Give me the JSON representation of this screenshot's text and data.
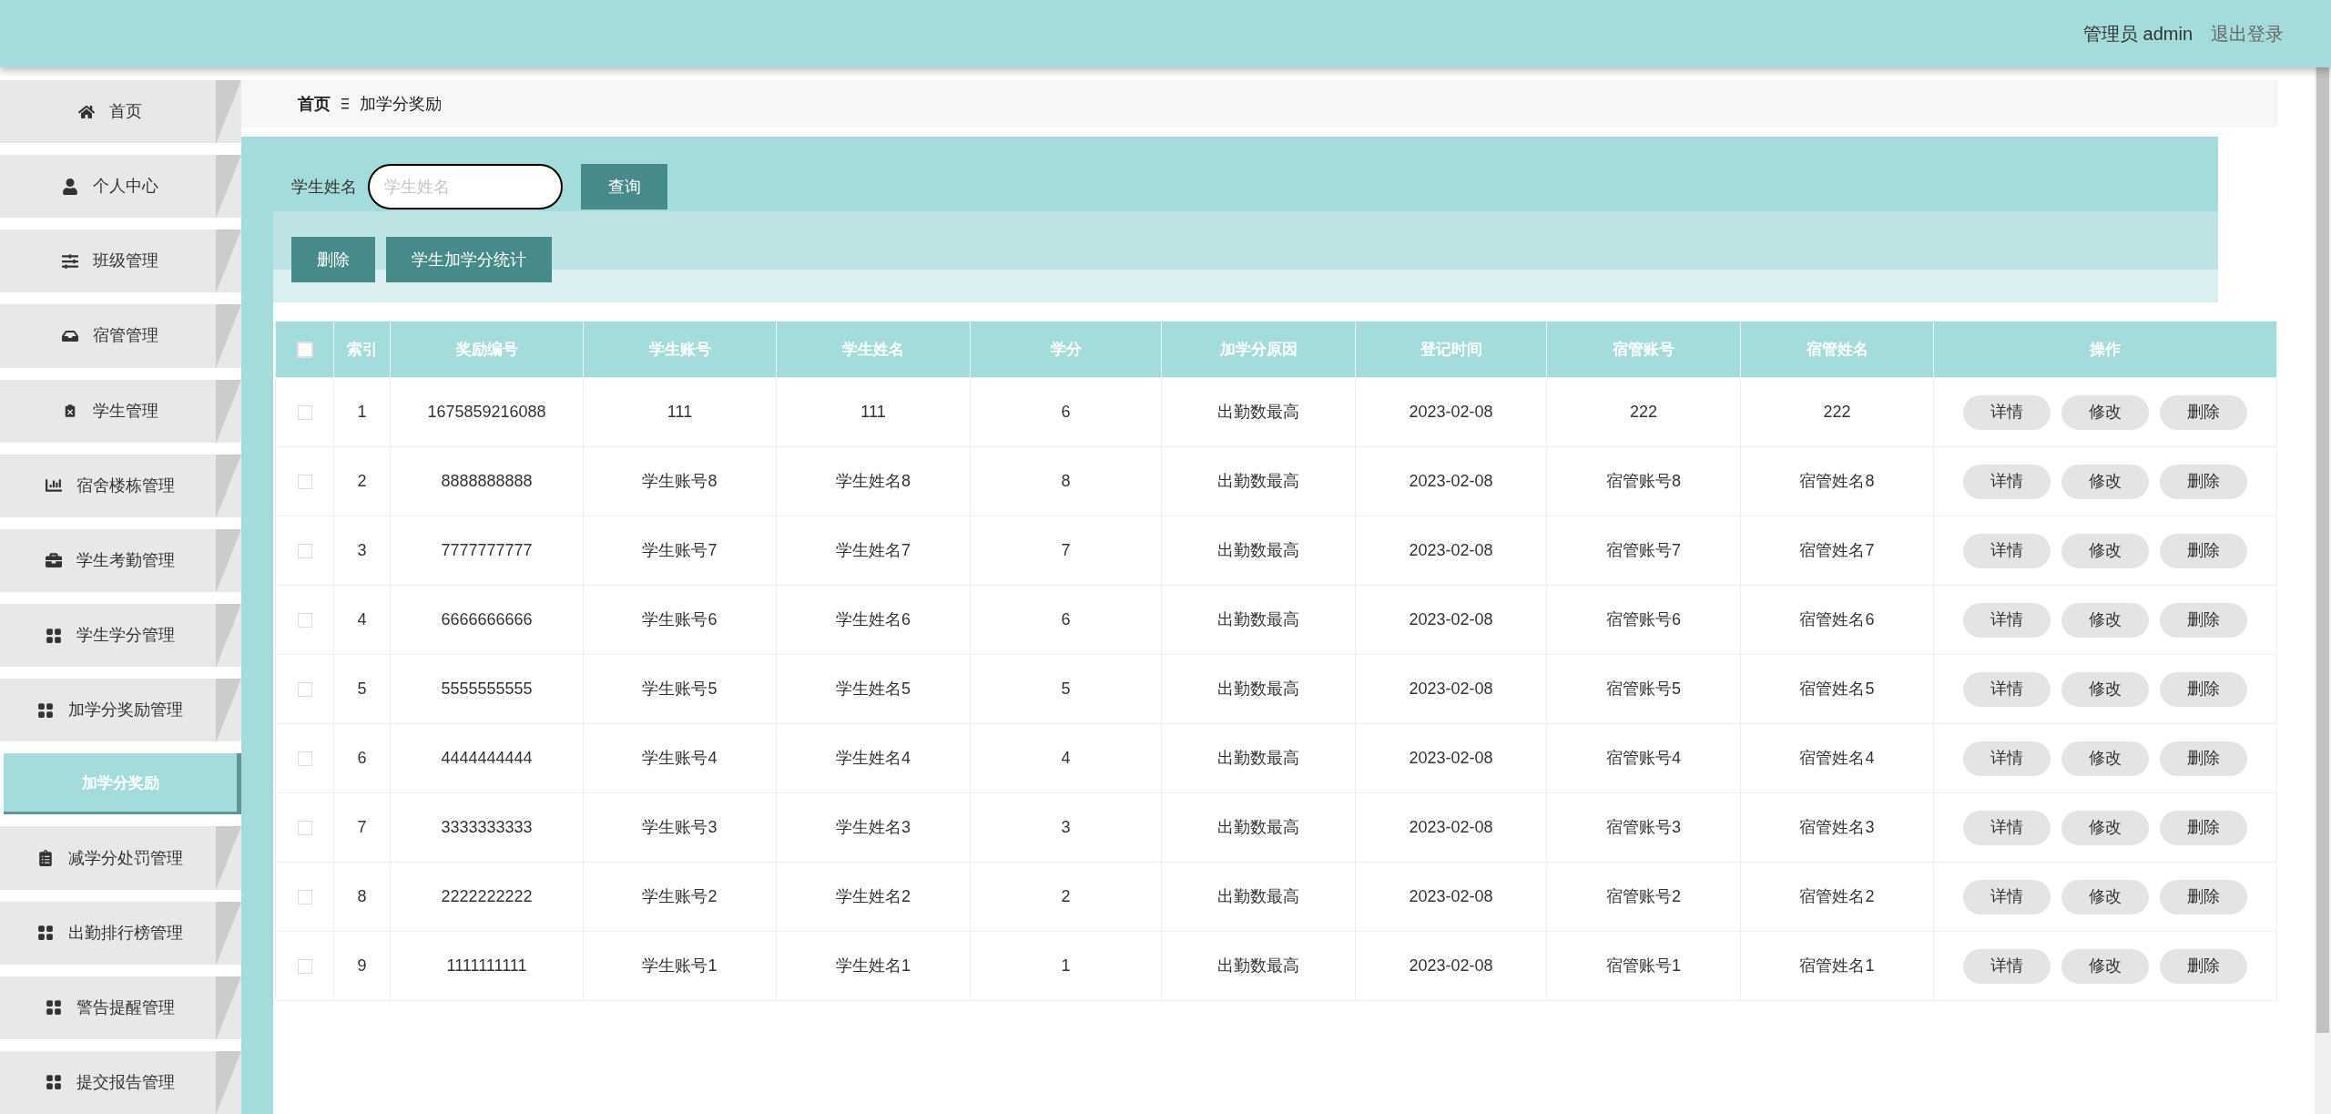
{
  "header": {
    "user_label": "管理员 admin",
    "logout": "退出登录"
  },
  "sidebar": {
    "items": [
      {
        "kind": "menu",
        "label": "首页",
        "selected": false
      },
      {
        "kind": "menu",
        "label": "个人中心",
        "selected": false
      },
      {
        "kind": "menu",
        "label": "班级管理",
        "selected": false
      },
      {
        "kind": "menu",
        "label": "宿管管理",
        "selected": false
      },
      {
        "kind": "menu",
        "label": "学生管理",
        "selected": false
      },
      {
        "kind": "menu",
        "label": "宿舍楼栋管理",
        "selected": false
      },
      {
        "kind": "menu",
        "label": "学生考勤管理",
        "selected": false
      },
      {
        "kind": "menu",
        "label": "学生学分管理",
        "selected": false
      },
      {
        "kind": "menu",
        "label": "加学分奖励管理",
        "selected": false
      },
      {
        "kind": "submenu",
        "label": "加学分奖励",
        "selected": true
      },
      {
        "kind": "menu",
        "label": "减学分处罚管理",
        "selected": false
      },
      {
        "kind": "menu",
        "label": "出勤排行榜管理",
        "selected": false
      },
      {
        "kind": "menu",
        "label": "警告提醒管理",
        "selected": false
      },
      {
        "kind": "menu",
        "label": "提交报告管理",
        "selected": false
      }
    ]
  },
  "breadcrumb": {
    "home": "首页",
    "current": "加学分奖励"
  },
  "search": {
    "label": "学生姓名",
    "placeholder": "学生姓名",
    "button": "查询"
  },
  "actions": [
    "删除",
    "学生加学分统计"
  ],
  "table": {
    "all_checked": false,
    "columns": [
      "索引",
      "奖励编号",
      "学生账号",
      "学生姓名",
      "学分",
      "加学分原因",
      "登记时间",
      "宿管账号",
      "宿管姓名",
      "操作"
    ],
    "rows": [
      {
        "checked": false,
        "cells": [
          "1",
          "1675859216088",
          "111",
          "111",
          "6",
          "出勤数最高",
          "2023-02-08",
          "222",
          "222"
        ],
        "buttons": [
          "详情",
          "修改",
          "删除"
        ]
      },
      {
        "checked": false,
        "cells": [
          "2",
          "8888888888",
          "学生账号8",
          "学生姓名8",
          "8",
          "出勤数最高",
          "2023-02-08",
          "宿管账号8",
          "宿管姓名8"
        ],
        "buttons": [
          "详情",
          "修改",
          "删除"
        ]
      },
      {
        "checked": false,
        "cells": [
          "3",
          "7777777777",
          "学生账号7",
          "学生姓名7",
          "7",
          "出勤数最高",
          "2023-02-08",
          "宿管账号7",
          "宿管姓名7"
        ],
        "buttons": [
          "详情",
          "修改",
          "删除"
        ]
      },
      {
        "checked": false,
        "cells": [
          "4",
          "6666666666",
          "学生账号6",
          "学生姓名6",
          "6",
          "出勤数最高",
          "2023-02-08",
          "宿管账号6",
          "宿管姓名6"
        ],
        "buttons": [
          "详情",
          "修改",
          "删除"
        ]
      },
      {
        "checked": false,
        "cells": [
          "5",
          "5555555555",
          "学生账号5",
          "学生姓名5",
          "5",
          "出勤数最高",
          "2023-02-08",
          "宿管账号5",
          "宿管姓名5"
        ],
        "buttons": [
          "详情",
          "修改",
          "删除"
        ]
      },
      {
        "checked": false,
        "cells": [
          "6",
          "4444444444",
          "学生账号4",
          "学生姓名4",
          "4",
          "出勤数最高",
          "2023-02-08",
          "宿管账号4",
          "宿管姓名4"
        ],
        "buttons": [
          "详情",
          "修改",
          "删除"
        ]
      },
      {
        "checked": false,
        "cells": [
          "7",
          "3333333333",
          "学生账号3",
          "学生姓名3",
          "3",
          "出勤数最高",
          "2023-02-08",
          "宿管账号3",
          "宿管姓名3"
        ],
        "buttons": [
          "详情",
          "修改",
          "删除"
        ]
      },
      {
        "checked": false,
        "cells": [
          "8",
          "2222222222",
          "学生账号2",
          "学生姓名2",
          "2",
          "出勤数最高",
          "2023-02-08",
          "宿管账号2",
          "宿管姓名2"
        ],
        "buttons": [
          "详情",
          "修改",
          "删除"
        ]
      },
      {
        "checked": false,
        "cells": [
          "9",
          "1111111111",
          "学生账号1",
          "学生姓名1",
          "1",
          "出勤数最高",
          "2023-02-08",
          "宿管账号1",
          "宿管姓名1"
        ],
        "buttons": [
          "详情",
          "修改",
          "删除"
        ]
      }
    ]
  }
}
